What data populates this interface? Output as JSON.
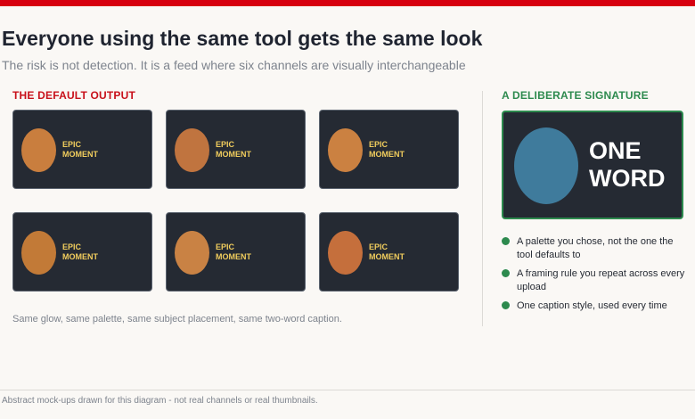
{
  "header": {
    "title": "Everyone using the same tool gets the same look",
    "subtitle": "The risk is not detection. It is a feed where six channels are visually interchangeable"
  },
  "default_output": {
    "label": "THE DEFAULT OUTPUT",
    "thumbnails": [
      {
        "line1": "EPIC",
        "line2": "MOMENT",
        "blob_color": "#c97e3e"
      },
      {
        "line1": "EPIC",
        "line2": "MOMENT",
        "blob_color": "#c0743f"
      },
      {
        "line1": "EPIC",
        "line2": "MOMENT",
        "blob_color": "#cb8141"
      },
      {
        "line1": "EPIC",
        "line2": "MOMENT",
        "blob_color": "#c27a37"
      },
      {
        "line1": "EPIC",
        "line2": "MOMENT",
        "blob_color": "#c98244"
      },
      {
        "line1": "EPIC",
        "line2": "MOMENT",
        "blob_color": "#c56f3c"
      }
    ],
    "note": "Same glow, same palette, same subject placement, same two-word caption."
  },
  "signature": {
    "label": "A DELIBERATE SIGNATURE",
    "word1": "ONE",
    "word2": "WORD",
    "blob_color": "#3f7b9c",
    "bullets": [
      "A palette you chose, not the one the tool defaults to",
      "A framing rule you repeat across every upload",
      "One caption style, used every time"
    ]
  },
  "colors": {
    "accent_red": "#d7000f",
    "accent_green": "#2d8a4e",
    "caption_yellow": "#f1cd5d",
    "thumb_bg": "#252a33"
  },
  "footer": "Abstract mock-ups drawn for this diagram - not real channels or real thumbnails."
}
